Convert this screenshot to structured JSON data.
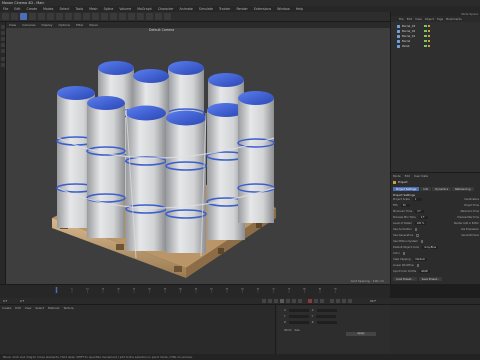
{
  "window": {
    "title": "Maxon Cinema 4D - Main"
  },
  "menubar": {
    "items": [
      "File",
      "Edit",
      "Create",
      "Modes",
      "Select",
      "Tools",
      "Mesh",
      "Spline",
      "Volume",
      "MoGraph",
      "Character",
      "Animate",
      "Simulate",
      "Tracker",
      "Render",
      "Extensions",
      "Window",
      "Help"
    ]
  },
  "viewport": {
    "menu": [
      "View",
      "Cameras",
      "Display",
      "Options",
      "Filter",
      "Panel"
    ],
    "camera_label": "Default Camera",
    "grid_spacing": "Grid Spacing : 100 cm"
  },
  "object_manager": {
    "header_right": "Node Space:",
    "menu": [
      "File",
      "Edit",
      "View",
      "Object",
      "Tags",
      "Bookmarks"
    ],
    "objects": [
      {
        "name": "Barrel_03"
      },
      {
        "name": "Barrel_02"
      },
      {
        "name": "Barrel_01"
      },
      {
        "name": "Barrel"
      },
      {
        "name": "Pallet"
      }
    ]
  },
  "attribute_manager": {
    "menu": [
      "Mode",
      "Edit",
      "User Data"
    ],
    "title": "Project",
    "tabs": [
      "Project Settings",
      "Info",
      "Dynamics",
      "Referencing"
    ],
    "section": "Project Settings",
    "rows": [
      {
        "label": "Project Scale",
        "value": "1",
        "right": "Centimeters"
      },
      {
        "label": "FPS",
        "value": "30",
        "right": "Project Time"
      },
      {
        "label": "Minimum Time",
        "value": "0 F",
        "right": "Maximum Time"
      },
      {
        "label": "Preview Min Time",
        "value": "0 F",
        "right": "Preview Max Time"
      },
      {
        "label": "Level of Detail",
        "value": "100 %",
        "right": "Render LOD in Editor"
      },
      {
        "label": "Use Animation",
        "value": "",
        "right": "Use Expression"
      },
      {
        "label": "Use Generators",
        "value": "",
        "right": "Use Deformers"
      },
      {
        "label": "Use Motion System",
        "value": "",
        "right": ""
      },
      {
        "label": "Default Object Color",
        "value": "Gray-Blue",
        "right": ""
      },
      {
        "label": "Color",
        "value": "",
        "right": ""
      },
      {
        "label": "View Clipping",
        "value": "Medium",
        "right": ""
      },
      {
        "label": "Linear Workflow",
        "value": "",
        "right": ""
      },
      {
        "label": "Input Color Profile",
        "value": "sRGB",
        "right": ""
      }
    ],
    "buttons": [
      "Load Preset...",
      "Save Preset..."
    ]
  },
  "timeline": {
    "ticks": [
      "0",
      "5",
      "10",
      "15",
      "20",
      "25",
      "30",
      "35",
      "40",
      "45",
      "50",
      "55",
      "60",
      "65",
      "70",
      "75",
      "80",
      "85",
      "90"
    ],
    "current_frame": "0 F",
    "end_frame": "90 F"
  },
  "materials": {
    "menu": [
      "Create",
      "Edit",
      "View",
      "Select",
      "Material",
      "Texture"
    ]
  },
  "coordinates": {
    "labels": [
      "X",
      "Y",
      "Z"
    ],
    "apply_label": "Apply",
    "mode_a": "World",
    "mode_b": "Size"
  },
  "status": {
    "text": "Move: Click and drag to move elements. Hold down SHIFT to quantize movement / add to the selection in point mode, CTRL to remove."
  },
  "colors": {
    "accent": "#4a6fb5",
    "barrel_lid": "#3a5fcf",
    "barrel_body": "#d9dadc",
    "pallet": "#c9a67a"
  }
}
